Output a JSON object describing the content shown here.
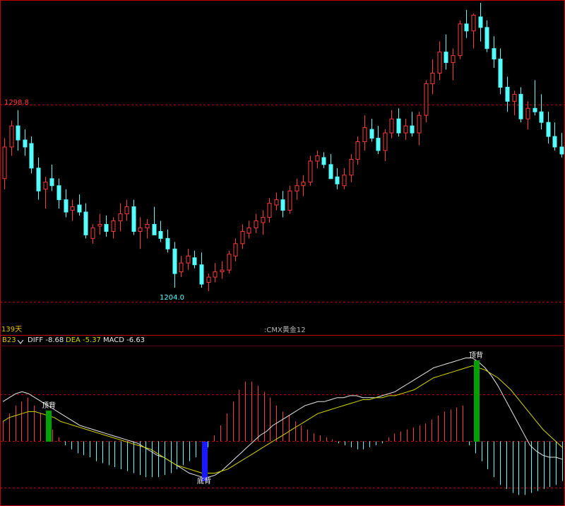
{
  "colors": {
    "background": "#000000",
    "up": "#ff3b3b",
    "down": "#54ffff",
    "diff": "#e8e8e8",
    "dea": "#d6d600",
    "dashed": "#c00000",
    "period_label": "#e8c000",
    "white": "#ffffff",
    "sig_green": "#00a000",
    "sig_blue": "#1a1aff"
  },
  "header": {
    "period_label": "139天",
    "instrument_title": ":CMX黄金12"
  },
  "indicator": {
    "selector_label": "B23",
    "selector_icon": "chevron-down-icon",
    "diff_label": "DIFF",
    "diff_value": "-8.68",
    "dea_label": "DEA",
    "dea_value": "-5.37",
    "macd_label": "MACD",
    "macd_value": "-6.63"
  },
  "chart_data": [
    {
      "type": "candlestick",
      "title": "CMX黄金12",
      "period": "139天",
      "high_label": "1298.8",
      "low_label": "1204.0",
      "series": [
        {
          "name": "candles",
          "values": [
            [
              1262,
              1285,
              1256,
              1280
            ],
            [
              1280,
              1295,
              1275,
              1292
            ],
            [
              1292,
              1301,
              1278,
              1284
            ],
            [
              1284,
              1290,
              1275,
              1280
            ],
            [
              1282,
              1286,
              1265,
              1268
            ],
            [
              1268,
              1274,
              1250,
              1255
            ],
            [
              1256,
              1263,
              1245,
              1260
            ],
            [
              1262,
              1270,
              1255,
              1258
            ],
            [
              1258,
              1262,
              1245,
              1250
            ],
            [
              1250,
              1256,
              1240,
              1243
            ],
            [
              1244,
              1250,
              1238,
              1246
            ],
            [
              1247,
              1253,
              1241,
              1243
            ],
            [
              1243,
              1248,
              1228,
              1230
            ],
            [
              1228,
              1236,
              1225,
              1234
            ],
            [
              1235,
              1242,
              1230,
              1236
            ],
            [
              1236,
              1241,
              1229,
              1232
            ],
            [
              1232,
              1240,
              1228,
              1238
            ],
            [
              1238,
              1248,
              1232,
              1242
            ],
            [
              1242,
              1250,
              1238,
              1246
            ],
            [
              1246,
              1250,
              1230,
              1232
            ],
            [
              1232,
              1240,
              1222,
              1234
            ],
            [
              1234,
              1239,
              1228,
              1236
            ],
            [
              1236,
              1246,
              1232,
              1230
            ],
            [
              1232,
              1238,
              1226,
              1228
            ],
            [
              1228,
              1233,
              1220,
              1222
            ],
            [
              1222,
              1226,
              1200,
              1208
            ],
            [
              1209,
              1218,
              1206,
              1214
            ],
            [
              1214,
              1222,
              1210,
              1218
            ],
            [
              1217,
              1221,
              1211,
              1213
            ],
            [
              1213,
              1220,
              1200,
              1202
            ],
            [
              1203,
              1208,
              1198,
              1206
            ],
            [
              1206,
              1214,
              1203,
              1209
            ],
            [
              1209,
              1215,
              1205,
              1210
            ],
            [
              1210,
              1221,
              1208,
              1219
            ],
            [
              1218,
              1228,
              1215,
              1225
            ],
            [
              1225,
              1236,
              1222,
              1232
            ],
            [
              1231,
              1238,
              1228,
              1234
            ],
            [
              1234,
              1242,
              1231,
              1238
            ],
            [
              1237,
              1244,
              1230,
              1240
            ],
            [
              1240,
              1251,
              1237,
              1248
            ],
            [
              1247,
              1254,
              1244,
              1250
            ],
            [
              1250,
              1255,
              1240,
              1244
            ],
            [
              1244,
              1258,
              1242,
              1255
            ],
            [
              1255,
              1262,
              1250,
              1258
            ],
            [
              1258,
              1264,
              1252,
              1260
            ],
            [
              1260,
              1275,
              1258,
              1272
            ],
            [
              1272,
              1278,
              1268,
              1275
            ],
            [
              1274,
              1277,
              1268,
              1270
            ],
            [
              1270,
              1276,
              1265,
              1262
            ],
            [
              1263,
              1268,
              1256,
              1259
            ],
            [
              1258,
              1268,
              1256,
              1264
            ],
            [
              1264,
              1276,
              1260,
              1273
            ],
            [
              1273,
              1286,
              1270,
              1283
            ],
            [
              1283,
              1298,
              1278,
              1291
            ],
            [
              1290,
              1296,
              1283,
              1285
            ],
            [
              1285,
              1292,
              1276,
              1278
            ],
            [
              1278,
              1290,
              1272,
              1288
            ],
            [
              1288,
              1301,
              1285,
              1296
            ],
            [
              1296,
              1302,
              1286,
              1288
            ],
            [
              1288,
              1296,
              1284,
              1292
            ],
            [
              1292,
              1300,
              1286,
              1288
            ],
            [
              1288,
              1300,
              1281,
              1298
            ],
            [
              1298,
              1318,
              1294,
              1316
            ],
            [
              1316,
              1330,
              1310,
              1322
            ],
            [
              1322,
              1340,
              1318,
              1334
            ],
            [
              1334,
              1344,
              1324,
              1328
            ],
            [
              1328,
              1336,
              1318,
              1332
            ],
            [
              1332,
              1352,
              1330,
              1350
            ],
            [
              1350,
              1358,
              1342,
              1346
            ],
            [
              1346,
              1356,
              1336,
              1355
            ],
            [
              1354,
              1362,
              1340,
              1348
            ],
            [
              1348,
              1352,
              1334,
              1336
            ],
            [
              1336,
              1343,
              1325,
              1330
            ],
            [
              1330,
              1336,
              1310,
              1314
            ],
            [
              1314,
              1320,
              1300,
              1306
            ],
            [
              1306,
              1312,
              1298,
              1310
            ],
            [
              1310,
              1314,
              1294,
              1296
            ],
            [
              1296,
              1306,
              1290,
              1302
            ],
            [
              1302,
              1318,
              1298,
              1300
            ],
            [
              1300,
              1310,
              1290,
              1294
            ],
            [
              1294,
              1300,
              1282,
              1286
            ],
            [
              1286,
              1294,
              1278,
              1280
            ],
            [
              1280,
              1288,
              1274,
              1276
            ]
          ]
        }
      ]
    },
    {
      "type": "bar",
      "title": "MACD",
      "series": [
        {
          "name": "MACD",
          "values": [
            10,
            14,
            18,
            20,
            22,
            18,
            14,
            10,
            6,
            2,
            -2,
            -4,
            -6,
            -7,
            -8,
            -10,
            -11,
            -12,
            -13,
            -14,
            -15,
            -16,
            -17,
            -18,
            -18,
            -18,
            -17,
            -16,
            -14,
            -12,
            -10,
            -8,
            -6,
            -3,
            3,
            8,
            14,
            20,
            26,
            30,
            30,
            28,
            25,
            22,
            18,
            15,
            13,
            10,
            8,
            6,
            4,
            3,
            2,
            1,
            -1,
            -2,
            -3,
            -4,
            -4,
            -3,
            -2,
            -1,
            2,
            4,
            5,
            6,
            7,
            8,
            9,
            11,
            13,
            15,
            16,
            17,
            18,
            -2,
            -6,
            -10,
            -14,
            -18,
            -22,
            -24,
            -26,
            -27,
            -27,
            -26,
            -25,
            -24,
            -23,
            -22,
            -20
          ]
        },
        {
          "name": "DIFF",
          "values": [
            20,
            22,
            24,
            25,
            24,
            22,
            20,
            18,
            16,
            14,
            12,
            10,
            8,
            7,
            6,
            5,
            4,
            3,
            2,
            1,
            0,
            -1,
            -3,
            -5,
            -7,
            -8,
            -10,
            -12,
            -14,
            -16,
            -17,
            -18,
            -18,
            -17,
            -15,
            -12,
            -9,
            -6,
            -3,
            0,
            3,
            5,
            8,
            10,
            12,
            14,
            16,
            18,
            19,
            20,
            20,
            21,
            22,
            22,
            23,
            23,
            22,
            22,
            22,
            23,
            24,
            25,
            27,
            29,
            31,
            33,
            35,
            37,
            38,
            39,
            40,
            41,
            42,
            42,
            40,
            37,
            33,
            28,
            22,
            16,
            10,
            4,
            -2,
            -5,
            -7,
            -8,
            -8,
            -9
          ]
        },
        {
          "name": "DEA",
          "values": [
            10,
            12,
            13,
            14,
            15,
            15,
            14,
            13,
            12,
            10,
            9,
            8,
            7,
            6,
            5,
            4,
            3,
            2,
            1,
            0,
            -1,
            -2,
            -3,
            -4,
            -6,
            -8,
            -10,
            -12,
            -13,
            -14,
            -15,
            -16,
            -16,
            -16,
            -15,
            -14,
            -12,
            -10,
            -8,
            -6,
            -4,
            -2,
            0,
            2,
            4,
            6,
            8,
            10,
            12,
            14,
            15,
            16,
            17,
            18,
            19,
            20,
            21,
            21,
            22,
            22,
            23,
            23,
            24,
            25,
            26,
            28,
            30,
            32,
            33,
            34,
            35,
            36,
            37,
            38,
            37,
            36,
            34,
            32,
            29,
            26,
            22,
            18,
            14,
            10,
            6,
            3,
            0,
            -3
          ]
        }
      ],
      "annotations": [
        "顶背",
        "底背",
        "顶背"
      ]
    }
  ]
}
